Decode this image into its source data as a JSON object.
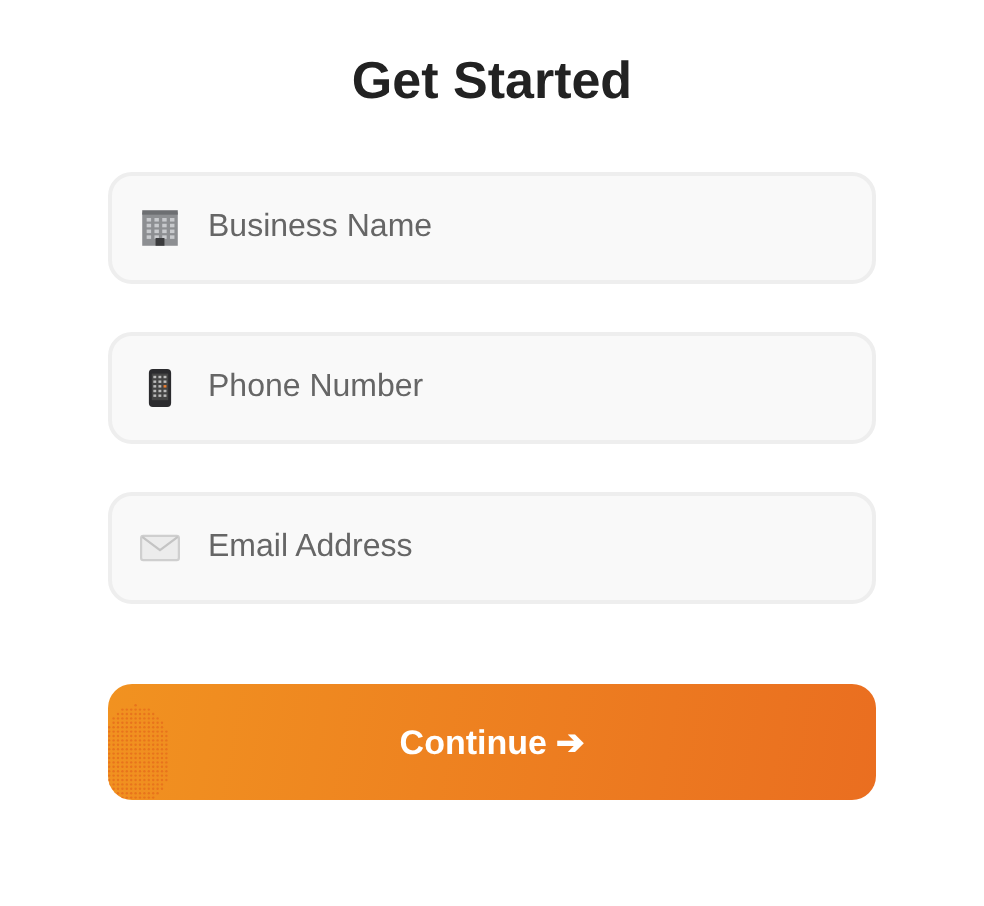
{
  "title": "Get Started",
  "fields": [
    {
      "kind": "building",
      "placeholder": "Business Name"
    },
    {
      "kind": "phone",
      "placeholder": "Phone Number"
    },
    {
      "kind": "envelope",
      "placeholder": "Email Address"
    }
  ],
  "button": {
    "label": "Continue ➔"
  }
}
